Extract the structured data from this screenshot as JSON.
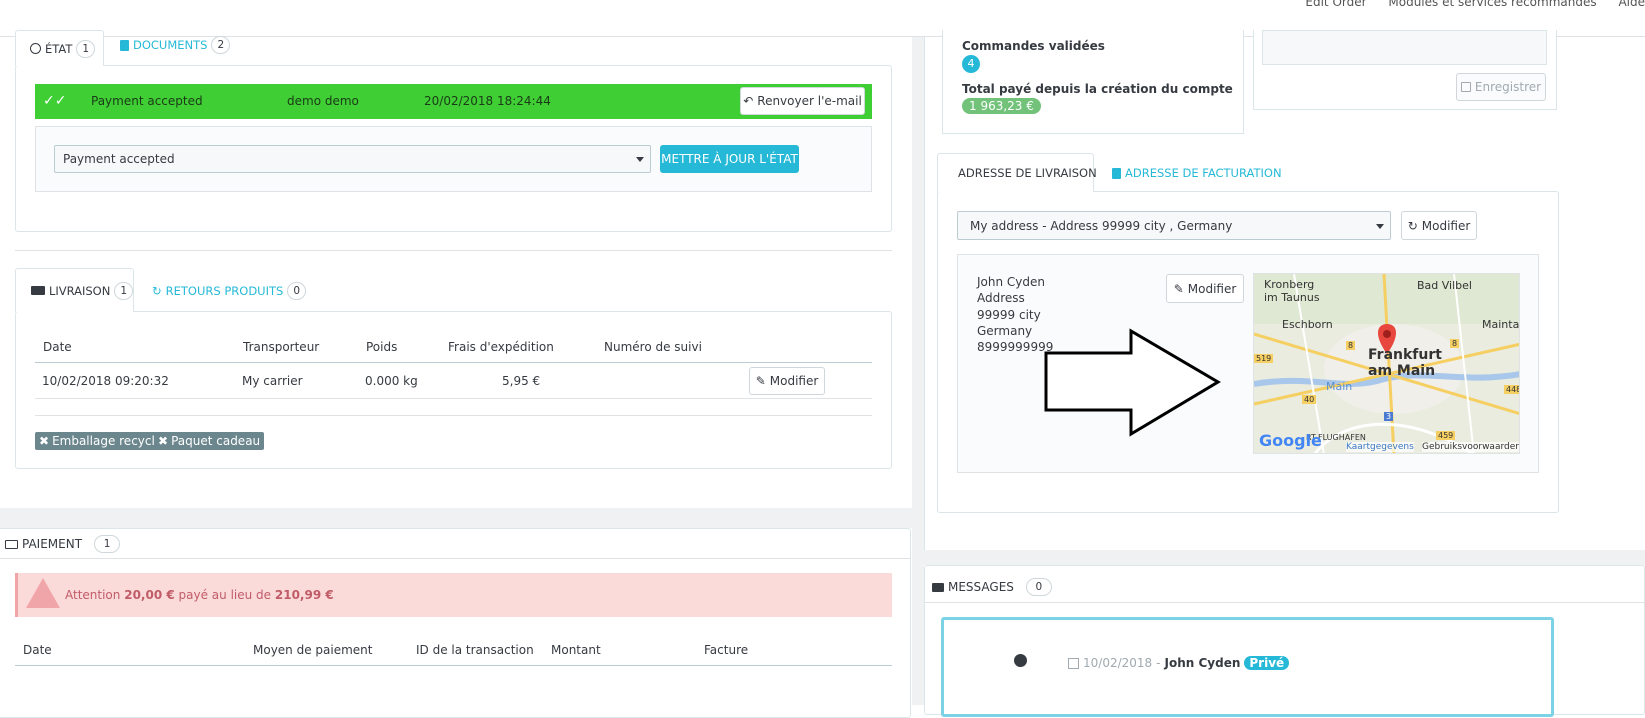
{
  "topbar": {
    "links": [
      "Edit Order",
      "Modules et services recommandés",
      "Aide"
    ]
  },
  "etat_panel": {
    "tabs": [
      {
        "label": "ÉTAT",
        "count": "1"
      },
      {
        "label": "DOCUMENTS",
        "count": "2"
      }
    ],
    "history_row": {
      "status": "Payment accepted",
      "employee": "demo demo",
      "date": "20/02/2018 18:24:44",
      "resend_label": "Renvoyer l'e-mail"
    },
    "status_select": "Payment accepted",
    "update_label": "METTRE À JOUR L'ÉTAT"
  },
  "shipping_panel": {
    "tabs": [
      {
        "label": "LIVRAISON",
        "count": "1"
      },
      {
        "label": "RETOURS PRODUITS",
        "count": "0"
      }
    ],
    "headers": [
      "Date",
      "Transporteur",
      "Poids",
      "Frais d'expédition",
      "Numéro de suivi"
    ],
    "row": {
      "date": "10/02/2018 09:20:32",
      "carrier": "My carrier",
      "weight": "0.000 kg",
      "cost": "5,95 €",
      "tracking": "",
      "edit_label": "Modifier"
    },
    "tags": [
      "Emballage recyclé",
      "Paquet cadeau"
    ]
  },
  "payment_panel": {
    "title": "PAIEMENT",
    "count": "1",
    "alert": {
      "prefix": "Attention",
      "paid": "20,00 €",
      "middle": "payé au lieu de",
      "expected": "210,99 €"
    },
    "headers": [
      "Date",
      "Moyen de paiement",
      "ID de la transaction",
      "Montant",
      "Facture"
    ]
  },
  "customer_panel": {
    "validated_label": "Commandes validées",
    "validated_count": "4",
    "total_label": "Total payé depuis la création du compte",
    "total_value": "1 963,23 €"
  },
  "note_panel": {
    "save_label": "Enregistrer"
  },
  "address_panel": {
    "tabs": [
      {
        "label": "ADRESSE DE LIVRAISON"
      },
      {
        "label": "ADRESSE DE FACTURATION"
      }
    ],
    "address_select": "My address - Address 99999 city , Germany",
    "change_label": "Modifier",
    "address_lines": [
      "John Cyden",
      "Address",
      "99999 city",
      "Germany",
      "8999999999"
    ],
    "edit_label": "Modifier",
    "map": {
      "city_line1": "Frankfurt",
      "city_line2": "am Main",
      "places": [
        "Kronberg",
        "im Taunus",
        "Bad Vilbel",
        "Eschborn",
        "Maintal",
        "Main",
        "RT-FLUGHAFEN"
      ],
      "road_numbers": [
        "519",
        "8",
        "8",
        "40",
        "3",
        "459",
        "448"
      ],
      "logo": "Google",
      "credits_link": "Kaartgegevens",
      "credits_terms": "Gebruiksvoorwaarden"
    }
  },
  "messages_panel": {
    "title": "MESSAGES",
    "count": "0",
    "message": {
      "date": "10/02/2018",
      "separator": "-",
      "author": "John Cyden",
      "badge": "Privé"
    }
  },
  "colors": {
    "accent": "#25b9d7",
    "success": "#3fcf35",
    "danger_bg": "#fbdada",
    "danger_text": "#c05c67",
    "tag": "#6c868e"
  }
}
